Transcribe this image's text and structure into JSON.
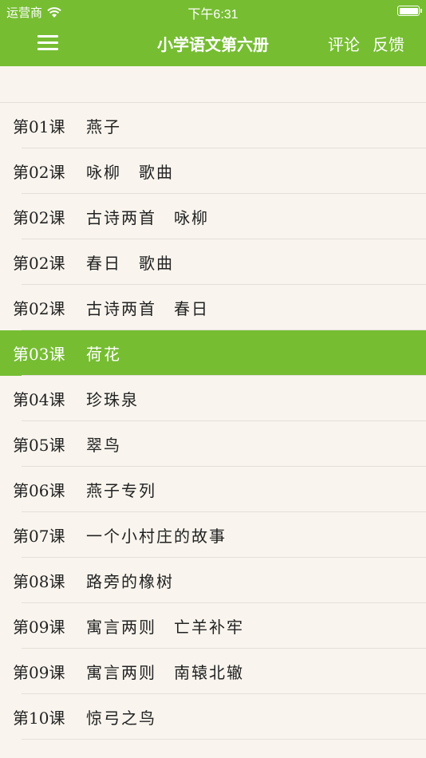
{
  "status_bar": {
    "carrier": "运营商",
    "time": "下午6:31"
  },
  "nav": {
    "title": "小学语文第六册",
    "comment_label": "评论",
    "feedback_label": "反馈"
  },
  "lessons": [
    {
      "num": "第01课",
      "title": "燕子"
    },
    {
      "num": "第02课",
      "title": "咏柳　歌曲"
    },
    {
      "num": "第02课",
      "title": "古诗两首　咏柳"
    },
    {
      "num": "第02课",
      "title": "春日　歌曲"
    },
    {
      "num": "第02课",
      "title": "古诗两首　春日"
    },
    {
      "num": "第03课",
      "title": "荷花",
      "selected": true
    },
    {
      "num": "第04课",
      "title": "珍珠泉"
    },
    {
      "num": "第05课",
      "title": "翠鸟"
    },
    {
      "num": "第06课",
      "title": "燕子专列"
    },
    {
      "num": "第07课",
      "title": "一个小村庄的故事"
    },
    {
      "num": "第08课",
      "title": "路旁的橡树"
    },
    {
      "num": "第09课",
      "title": "寓言两则　亡羊补牢"
    },
    {
      "num": "第09课",
      "title": "寓言两则　南辕北辙"
    },
    {
      "num": "第10课",
      "title": "惊弓之鸟"
    }
  ],
  "colors": {
    "accent": "#76bd32",
    "background": "#f9f5ee"
  }
}
